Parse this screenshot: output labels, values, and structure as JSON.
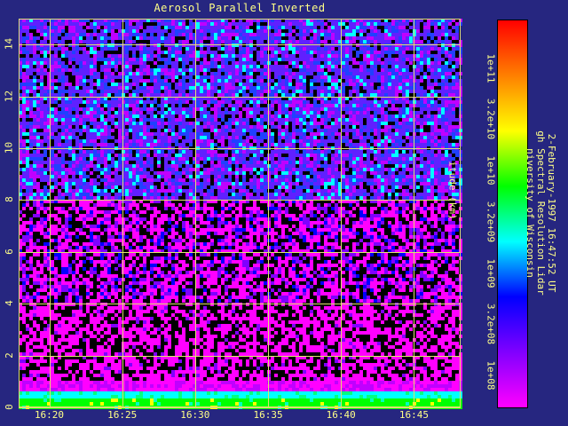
{
  "chart_data": {
    "type": "heatmap",
    "title": "Aerosol Parallel Inverted",
    "xlabel": "",
    "ylabel": "itude (km)",
    "x_tick_labels": [
      "16:20",
      "16:25",
      "16:30",
      "16:35",
      "16:40",
      "16:45"
    ],
    "x_ticks_minutes": [
      980,
      985,
      990,
      995,
      1000,
      1005
    ],
    "xlim_minutes": [
      977.9,
      1008.2
    ],
    "y_tick_labels": [
      "0",
      "2",
      "4",
      "6",
      "8",
      "10",
      "12",
      "14"
    ],
    "y_ticks": [
      0,
      2,
      4,
      6,
      8,
      10,
      12,
      14
    ],
    "ylim": [
      0,
      15
    ],
    "grid": true,
    "colorbar": {
      "scale": "log",
      "range": [
        50000000.0,
        300000000000.0
      ],
      "tick_labels": [
        "1e+08",
        "3.2e+08",
        "1e+09",
        "3.2e+09",
        "1e+10",
        "3.2e+10",
        "1e+11"
      ],
      "tick_values": [
        100000000.0,
        320000000.0,
        1000000000.0,
        3200000000.0,
        10000000000.0,
        32000000000.0,
        100000000000.0
      ],
      "colors": [
        "#ff00ff",
        "#8000ff",
        "#0000ff",
        "#00ffff",
        "#00ff00",
        "#ffff00",
        "#ff8000",
        "#ff0000"
      ]
    },
    "profile_description": [
      {
        "altitude_km": [
          0.0,
          0.6
        ],
        "level": "3.2e+09"
      },
      {
        "altitude_km": [
          0.6,
          4.0
        ],
        "level": "1e+08"
      },
      {
        "altitude_km": [
          4.0,
          8.0
        ],
        "level": "1e+08 to 2e+08"
      },
      {
        "altitude_km": [
          8.0,
          15.0
        ],
        "level": "2e+08 to 1e+09"
      }
    ]
  },
  "info_lines": [
    "niversity of Wisconsin",
    "gh Spectral Resolution Lidar",
    "2-February-1997 16:47:52 UT"
  ],
  "colors": {
    "background": "#262680",
    "text": "#ffff88",
    "grid": "#e0e070"
  }
}
